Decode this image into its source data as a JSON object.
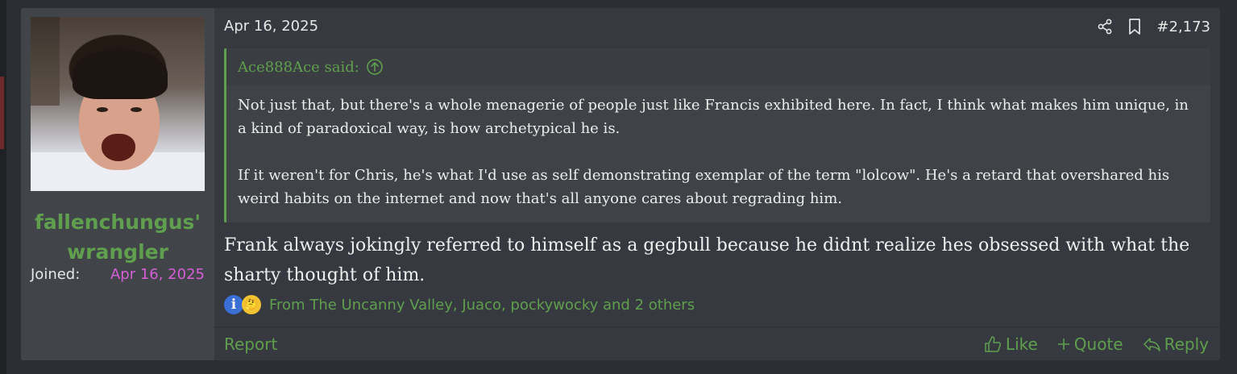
{
  "user": {
    "name_line1": "fallenchungus'",
    "name_line2": "wrangler",
    "joined_label": "Joined:",
    "joined_date": "Apr 16, 2025"
  },
  "post": {
    "date": "Apr 16, 2025",
    "number": "#2,173",
    "quote": {
      "author_line": "Ace888Ace said:",
      "paragraph1": "Not just that, but there's a whole menagerie of people just like Francis exhibited here. In fact, I think what makes him unique, in a kind of paradoxical way, is how archetypical he is.",
      "paragraph2": "If it weren't for Chris, he's what I'd use as self demonstrating exemplar of the term \"lolcow\". He's a retard that overshared his weird habits on the internet and now that's all anyone cares about regrading him."
    },
    "body": "Frank always jokingly referred to himself as a gegbull because he didnt realize hes obsessed with what the sharty thought of him.",
    "reactions": {
      "icons": [
        "informative-icon",
        "thinking-icon"
      ],
      "text": "From The Uncanny Valley, Juaco, pockywocky and 2 others"
    }
  },
  "footer": {
    "report": "Report",
    "like": "Like",
    "quote": "Quote",
    "reply": "Reply"
  },
  "colors": {
    "accent": "#5f9f4e",
    "joined_date": "#d65fd6",
    "post_bg": "#36393f",
    "user_col_bg": "#414449"
  }
}
